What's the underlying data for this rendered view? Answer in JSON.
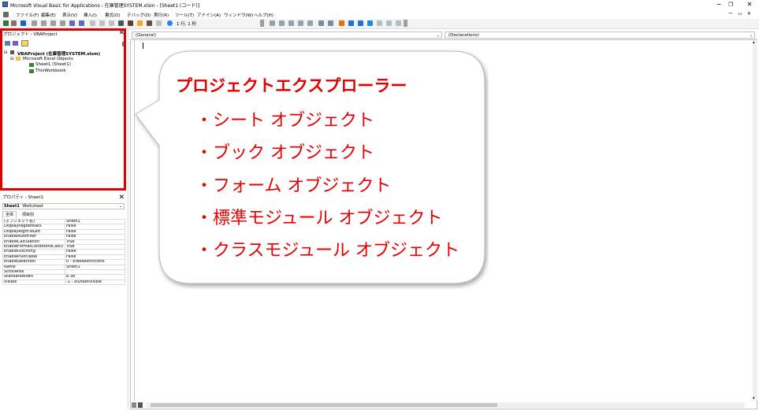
{
  "window": {
    "title": "Microsoft Visual Basic for Applications - 在庫管理SYSTEM.xlsm - [Sheet1 (コード)]",
    "controls": [
      "−",
      "❐",
      "✕"
    ],
    "inner_controls": [
      "−",
      "▭",
      "✕"
    ]
  },
  "menu": {
    "items": [
      "ファイル(F)",
      "編集(E)",
      "表示(V)",
      "挿入(I)",
      "書式(O)",
      "デバッグ(D)",
      "実行(R)",
      "ツール(T)",
      "アドイン(A)",
      "ウィンドウ(W)",
      "ヘルプ(H)"
    ]
  },
  "toolbar": {
    "position_text": "1 行, 1 桁"
  },
  "project_pane": {
    "title": "プロジェクト - VBAProject",
    "close": "✕",
    "tree": {
      "root": "VBAProject (在庫管理SYSTEM.xlsm)",
      "folder": "Microsoft Excel Objects",
      "sheet": "Sheet1 (Sheet1)",
      "workbook": "ThisWorkbook"
    }
  },
  "properties_pane": {
    "title": "プロパティ - Sheet1",
    "close": "✕",
    "object_selector": {
      "name": "Sheet1",
      "type": "Worksheet"
    },
    "tabs": [
      "全体",
      "項目別"
    ],
    "rows": [
      [
        "(オブジェクト名)",
        "Sheet1"
      ],
      [
        "DisplayPageBreaks",
        "False"
      ],
      [
        "DisplayRightToLeft",
        "False"
      ],
      [
        "EnableAutoFilter",
        "False"
      ],
      [
        "EnableCalculation",
        "True"
      ],
      [
        "EnableFormatConditionsCalcu",
        "True"
      ],
      [
        "EnableOutlining",
        "False"
      ],
      [
        "EnablePivotTable",
        "False"
      ],
      [
        "EnableSelection",
        "0 - xlNoRestrictions"
      ],
      [
        "Name",
        "Sheet1"
      ],
      [
        "ScrollArea",
        ""
      ],
      [
        "StandardWidth",
        "8.38"
      ],
      [
        "Visible",
        "-1 - xlSheetVisible"
      ]
    ]
  },
  "code_window": {
    "object_combo": "(General)",
    "procedure_combo": "(Declarations)"
  },
  "callout": {
    "heading": "プロジェクトエクスプローラー",
    "items": [
      "・シート オブジェクト",
      "・ブック オブジェクト",
      "・フォーム オブジェクト",
      "・標準モジュール オブジェクト",
      "・クラスモジュール オブジェクト"
    ]
  },
  "colors": {
    "highlight": "#e00000",
    "callout_text": "#e60000"
  }
}
